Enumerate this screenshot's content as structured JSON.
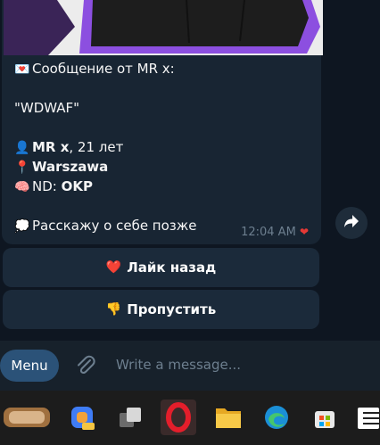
{
  "message": {
    "header": "Сообщение от MR x:",
    "quote": "\"WDWAF\"",
    "name_bold": "MR x",
    "age_text": ", 21 лет",
    "city": "Warszawa",
    "nd_label": "ND: ",
    "nd_value": "OKP",
    "about": "Расскажу о себе позже",
    "time": "12:04 AM"
  },
  "buttons": {
    "like_label": "Лайк назад",
    "skip_label": "Пропустить"
  },
  "composer": {
    "menu_label": "Menu",
    "placeholder": "Write a message..."
  },
  "icons": {
    "share": "share-icon",
    "attach": "paperclip-icon"
  },
  "colors": {
    "background": "#0e1621",
    "bubble": "#182533",
    "accent": "#2b5278"
  }
}
